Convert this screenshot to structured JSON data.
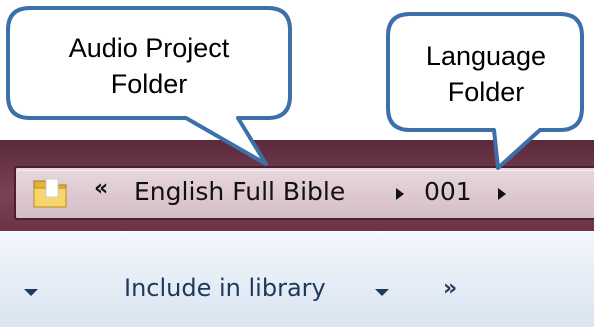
{
  "callouts": {
    "audio_project": {
      "line1": "Audio Project",
      "line2": "Folder"
    },
    "language": {
      "line1": "Language",
      "line2": "Folder"
    }
  },
  "address_bar": {
    "overflow_chevrons": "«",
    "crumbs": [
      "English Full Bible",
      "001"
    ],
    "folder_icon": "folder-icon"
  },
  "toolbar": {
    "include_in_library_label": "Include in library",
    "more_chevrons": "»"
  },
  "colors": {
    "callout_fill": "#ffffff",
    "callout_border": "#3d6fa8",
    "frame": "#6c3649",
    "address_bg": "#ddc8d0",
    "toolbar_text": "#1e395b"
  }
}
